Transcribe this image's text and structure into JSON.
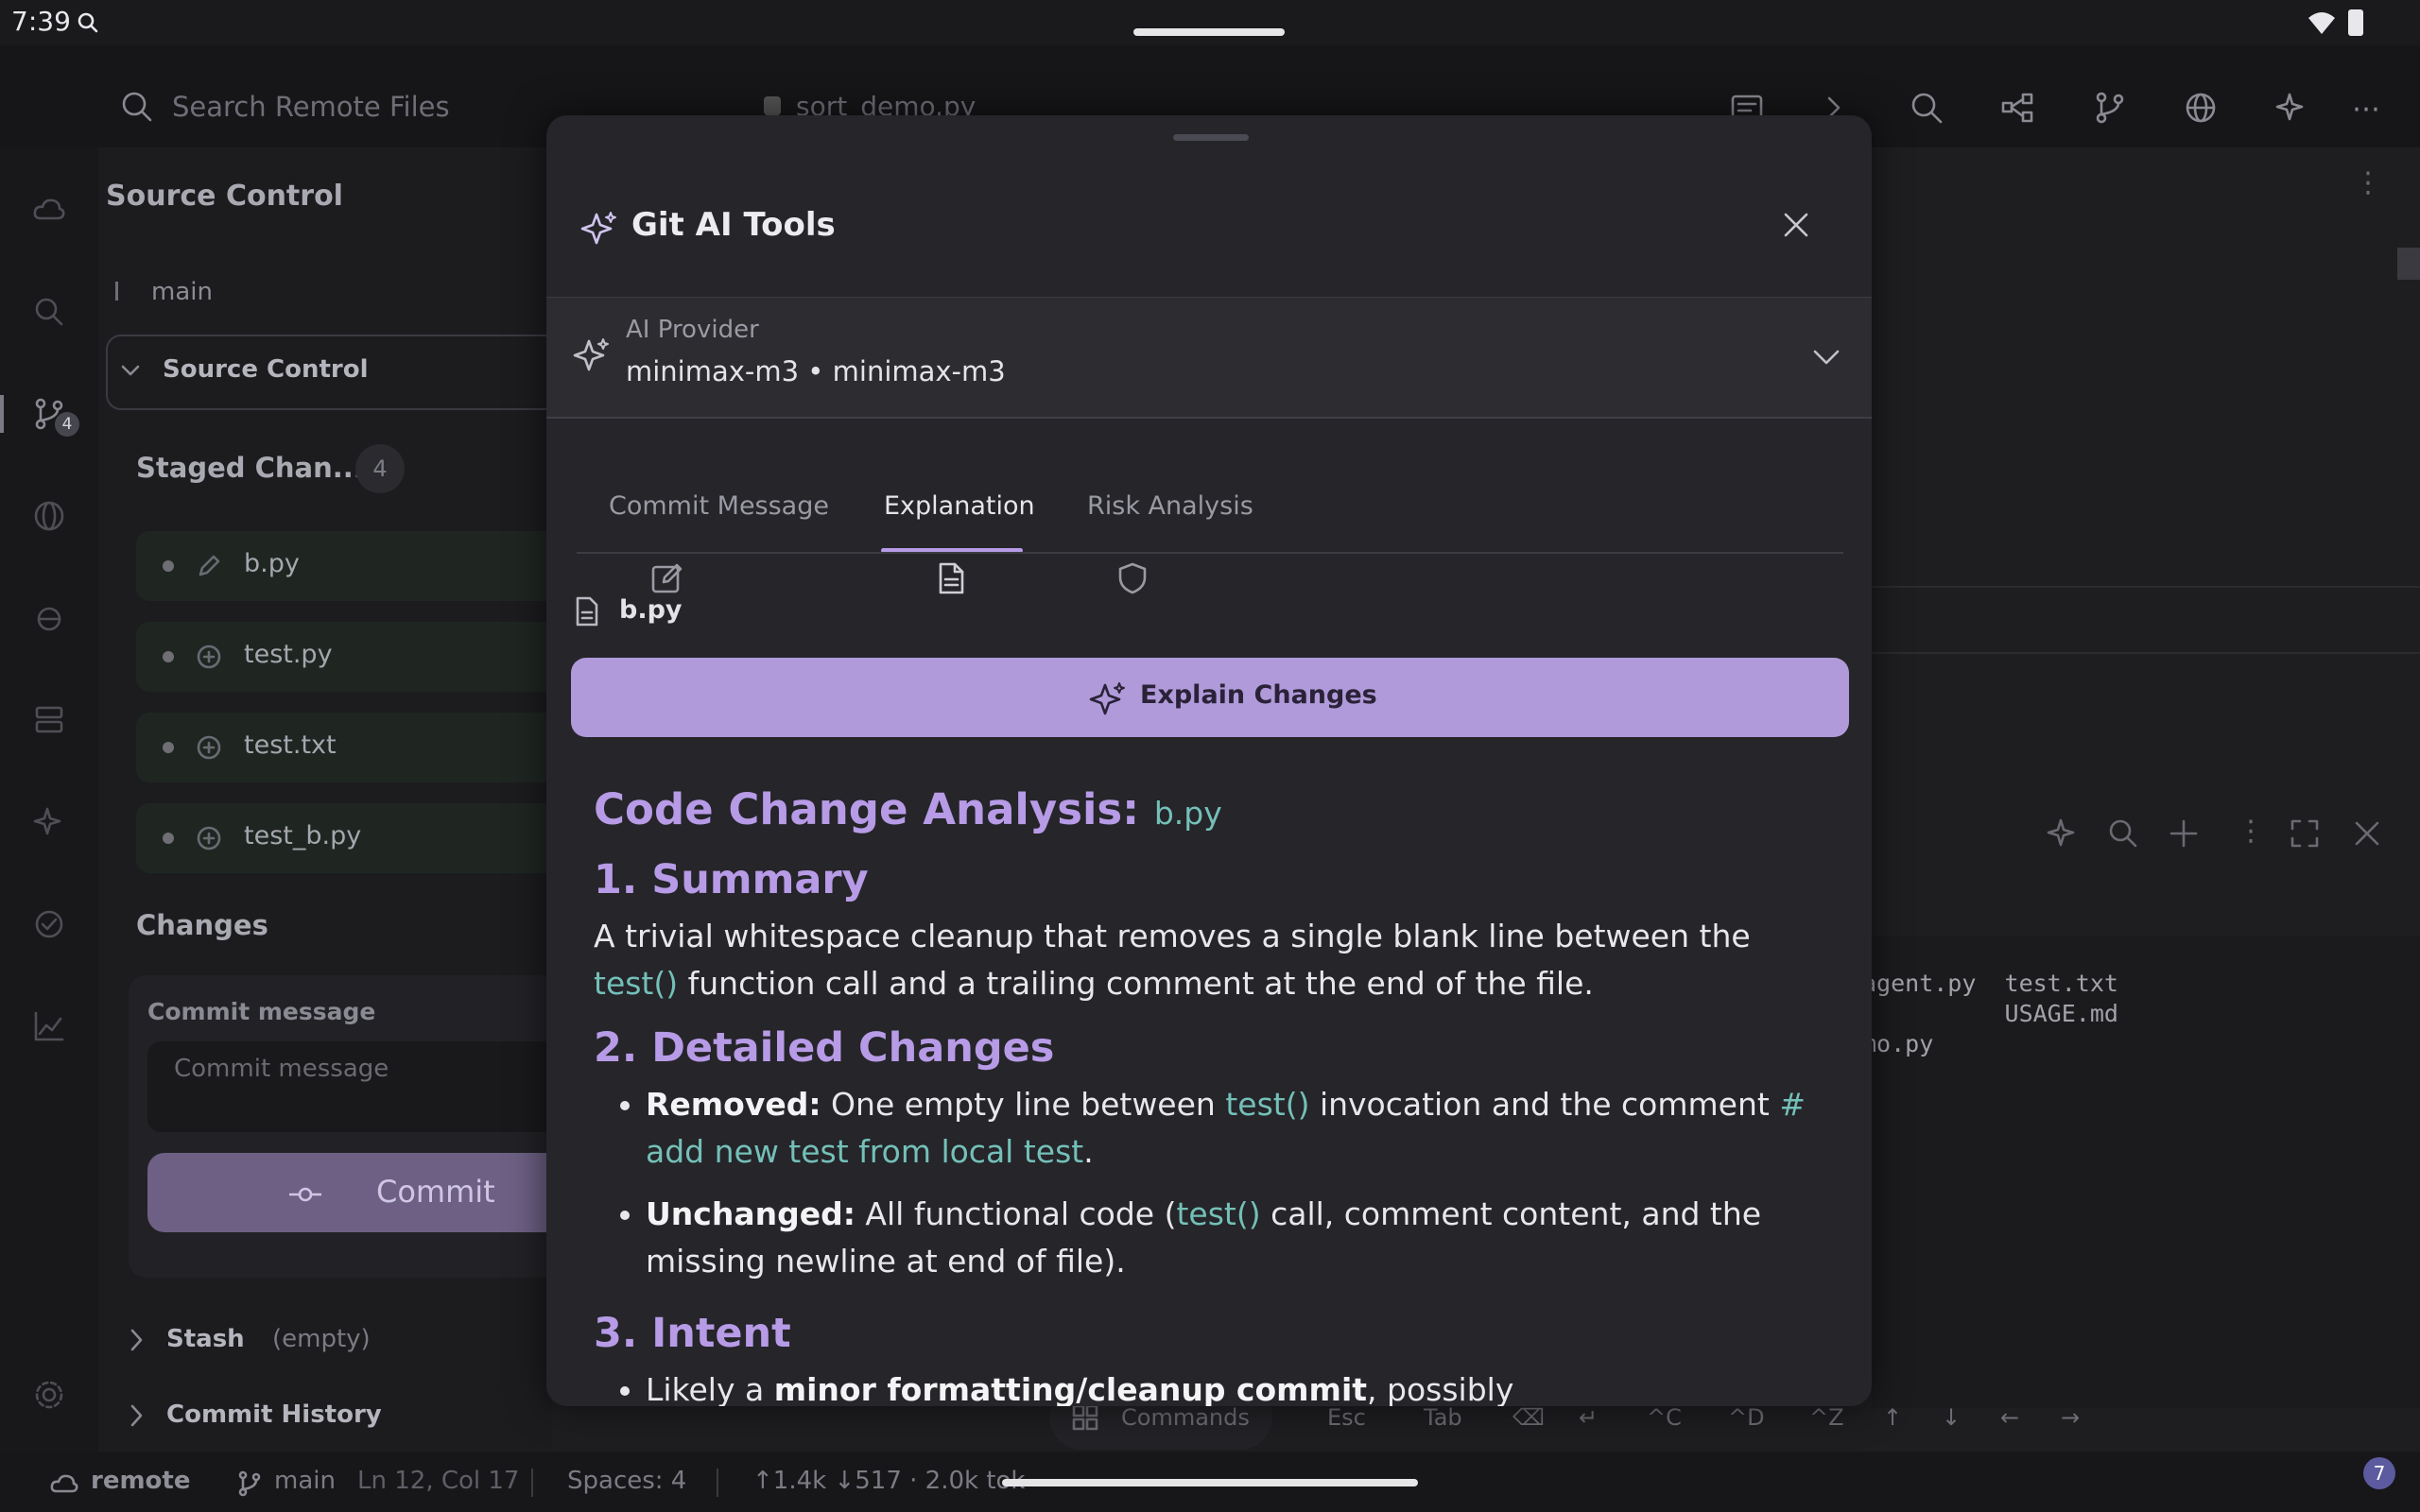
{
  "status_bar": {
    "time": "7:39"
  },
  "top_bar": {
    "search_placeholder": "Search Remote Files",
    "editor_tab": "sort_demo.py"
  },
  "rail": {
    "source_control_badge": "4"
  },
  "side_panel": {
    "title": "Source Control",
    "branch": "main",
    "section_label": "Source Control",
    "staged_title": "Staged Chan...",
    "staged_count": "4",
    "staged_files": [
      {
        "name": "b.py",
        "icon": "pencil-icon"
      },
      {
        "name": "test.py",
        "icon": "plus-circle-icon"
      },
      {
        "name": "test.txt",
        "icon": "plus-circle-icon"
      },
      {
        "name": "test_b.py",
        "icon": "plus-circle-icon"
      }
    ],
    "changes_title": "Changes",
    "commit_label": "Commit message",
    "commit_placeholder": "Commit message",
    "commit_button": "Commit",
    "stash_label": "Stash",
    "stash_note": "(empty)",
    "history_label": "Commit History"
  },
  "terminal": {
    "lines": [
      "agent.py  test.txt",
      "          USAGE.md",
      "mo.py"
    ]
  },
  "keyboard_bar": {
    "commands": "Commands",
    "keys": [
      "Esc",
      "Tab",
      "⌫",
      "↵",
      "^C",
      "^D",
      "^Z",
      "↑",
      "↓",
      "←",
      "→"
    ]
  },
  "bottom_bar": {
    "remote": "remote",
    "branch": "main",
    "position": "Ln 12, Col 17",
    "spaces": "Spaces: 4",
    "tokens": "↑1.4k ↓517 · 2.0k tok",
    "notifications": "7"
  },
  "modal": {
    "title": "Git AI Tools",
    "provider_label": "AI Provider",
    "provider_value": "minimax-m3 • minimax-m3",
    "tabs": [
      {
        "label": "Commit Message",
        "icon": "edit-icon"
      },
      {
        "label": "Explanation",
        "icon": "document-icon",
        "active": true
      },
      {
        "label": "Risk Analysis",
        "icon": "shield-icon"
      }
    ],
    "file": "b.py",
    "explain_button": "Explain Changes",
    "content": {
      "heading": "Code Change Analysis:",
      "heading_file": "b.py",
      "s1_title": "1. Summary",
      "s1_text_a": "A trivial whitespace cleanup that removes a single blank line between the ",
      "s1_code": "test()",
      "s1_text_b": " function call and a trailing comment at the end of the file.",
      "s2_title": "2. Detailed Changes",
      "b1_bold": "Removed:",
      "b1_text_a": " One empty line between ",
      "b1_code1": "test()",
      "b1_text_b": " invocation and the comment ",
      "b1_code2": "# add new test from local test",
      "b1_text_c": ".",
      "b2_bold": "Unchanged:",
      "b2_text_a": " All functional code (",
      "b2_code": "test()",
      "b2_text_b": " call, comment content, and the missing newline at end of file).",
      "s3_title": "3. Intent",
      "b3_text_a": "Likely a ",
      "b3_bold": "minor formatting/cleanup commit",
      "b3_text_b": ", possibly"
    }
  }
}
